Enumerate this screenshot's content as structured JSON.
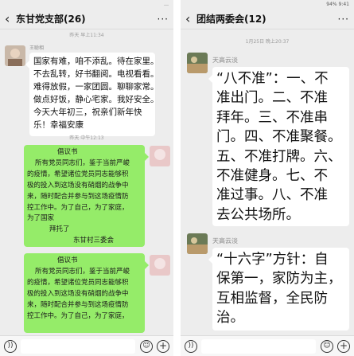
{
  "left": {
    "status": "…",
    "title": "东甘党支部(26)",
    "time1": "昨天 早上11:34",
    "sender1": "王聪相",
    "msg1_lines": [
      "国家有难，咱不添乱。待在家里。",
      "不去乱转，好书翻阅。电视看看。",
      "难得放假，一家团圆。聊聊家常。",
      "做点好饭，静心宅家。我好安全。",
      "今天大年初三，祝亲们新年快",
      "乐！幸福安康"
    ],
    "time2": "昨天 中午12:13",
    "msg2_lines": [
      "倡议书",
      "所有党员同志们，鉴于当前严峻",
      "的疫情，希望诸位党员同志能够积",
      "极的投入到这场没有硝烟的战争中",
      "来，随时配合并参与到这场疫情防",
      "控工作中。为了自己，为了家庭，",
      "为了国家",
      "拜托了",
      "东甘村三委会"
    ],
    "msg3_lines": [
      "倡议书",
      "所有党员同志们，鉴于当前严峻",
      "的疫情，希望诸位党员同志能够积",
      "极的投入到这场没有硝烟的战争中",
      "来，随时配合并参与到这场疫情防",
      "控工作中。为了自己，为了家庭，"
    ]
  },
  "right": {
    "status": "94% 9:41",
    "title": "团结两委会(12)",
    "time1": "1月25日 晚上20:37",
    "sender1": "天高云淡",
    "msg1_lines": [
      "“八不准”：一、不",
      "准出门。二、不准",
      "拜年。三、不准串",
      "门。四、不准聚餐。",
      "五、不准打牌。六、",
      "不准健身。七、不",
      "准过事。八、不准",
      "去公共场所。"
    ],
    "sender2": "天高云淡",
    "msg2_lines": [
      "“十六字”方针：自",
      "保第一，家防为主，",
      "互相监督，全民防",
      "治。"
    ]
  },
  "icons": {
    "back": "chevron-left-icon",
    "more": "more-dots-icon",
    "voice": "voice-icon",
    "emoji": "emoji-icon",
    "add": "add-icon"
  },
  "colors": {
    "chat_bg": "#ededed",
    "green_bubble": "#95ec69",
    "white_bubble": "#ffffff"
  }
}
